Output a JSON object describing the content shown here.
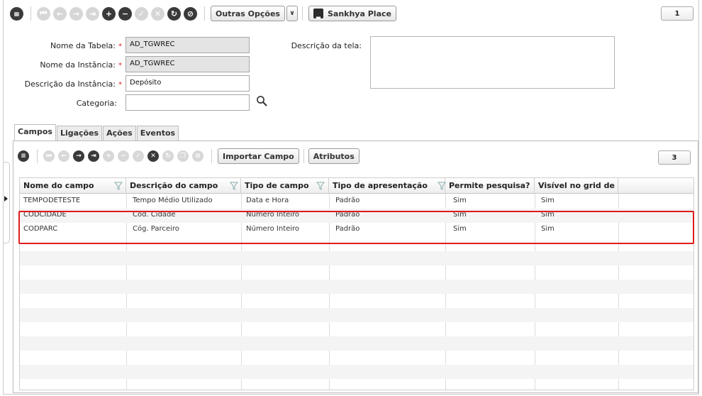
{
  "toolbar": {
    "outras_opcoes_label": "Outras Opções",
    "sankhya_place_label": "Sankhya Place",
    "page_counter": "1"
  },
  "form": {
    "nome_tabela_label": "Nome da Tabela:",
    "nome_tabela_value": "AD_TGWREC",
    "nome_instancia_label": "Nome da Instância:",
    "nome_instancia_value": "AD_TGWREC",
    "descricao_instancia_label": "Descrição da Instância:",
    "descricao_instancia_value": "Depósito",
    "categoria_label": "Categoria:",
    "categoria_value": "",
    "descricao_tela_label": "Descrição da tela:",
    "descricao_tela_value": "",
    "required_mark": "*"
  },
  "tabs": [
    {
      "label": "Campos",
      "active": true
    },
    {
      "label": "Ligações",
      "active": false
    },
    {
      "label": "Ações",
      "active": false
    },
    {
      "label": "Eventos",
      "active": false
    }
  ],
  "grid_toolbar": {
    "importar_campo_label": "Importar Campo",
    "atributos_label": "Atributos",
    "record_counter": "3"
  },
  "grid": {
    "columns": [
      "Nome do campo",
      "Descrição do campo",
      "Tipo de campo",
      "Tipo de apresentação",
      "Permite pesquisa?",
      "Visível no grid de"
    ],
    "rows": [
      [
        "TEMPODETESTE",
        "Tempo Médio Utilizado",
        "Data e Hora",
        "Padrão",
        "Sim",
        "Sim"
      ],
      [
        "CODCIDADE",
        "Cód. Cidade",
        "Número Inteiro",
        "Padrão",
        "Sim",
        "Sim"
      ],
      [
        "CODPARC",
        "Cóg. Parceiro",
        "Número Inteiro",
        "Padrão",
        "Sim",
        "Sim"
      ]
    ]
  },
  "colors": {
    "highlight_border": "#e11b1b",
    "required_mark": "#e02020",
    "readonly_field": "#e4e4e4",
    "dark_button": "#3a3a3a",
    "disabled_button": "#d6d6d6"
  }
}
